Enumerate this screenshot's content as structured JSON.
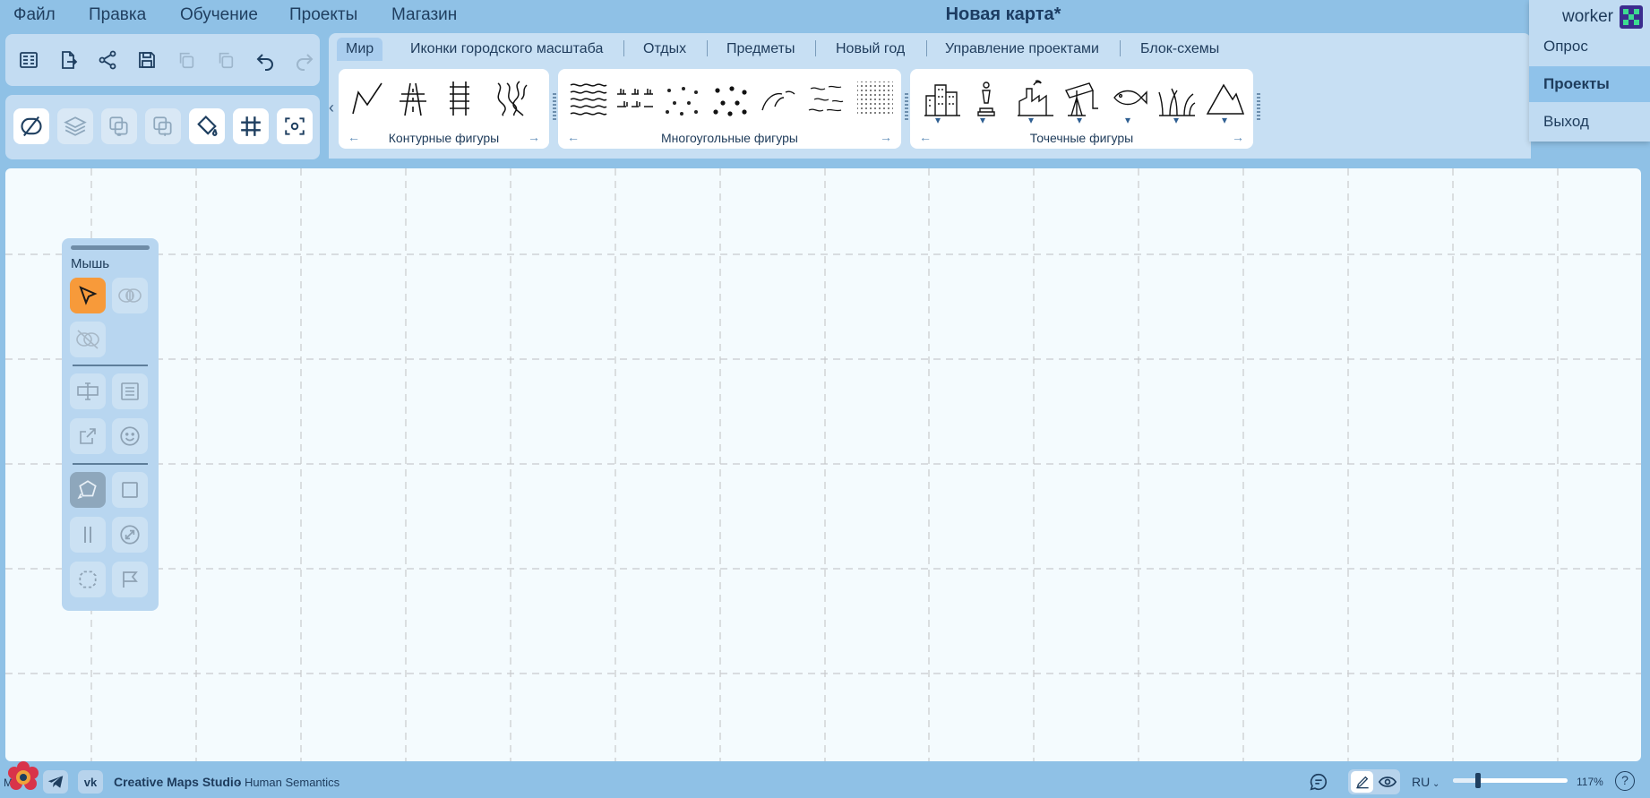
{
  "menu": {
    "items": [
      "Файл",
      "Правка",
      "Обучение",
      "Проекты",
      "Магазин"
    ],
    "title": "Новая карта*"
  },
  "user": {
    "name": "worker",
    "dropdown": [
      "Опрос",
      "Проекты",
      "Выход"
    ],
    "selected": "Проекты"
  },
  "tabs": [
    "Мир",
    "Иконки городского масштаба",
    "Отдых",
    "Предметы",
    "Новый год",
    "Управление проектами",
    "Блок-схемы"
  ],
  "active_tab": "Мир",
  "shape_groups": {
    "contour": {
      "label": "Контурные фигуры"
    },
    "polygon": {
      "label": "Многоугольные фигуры"
    },
    "point": {
      "label": "Точечные фигуры"
    }
  },
  "toolpanel": {
    "title": "Мышь"
  },
  "status": {
    "app_name": "Creative Maps Studio",
    "app_suffix": " - Human Semantics",
    "lang": "RU",
    "zoom": "117%",
    "zoom_fraction": 0.22,
    "left_char": "M"
  },
  "colors": {
    "accent_orange": "#f79a3a",
    "bg_blue": "#8fc1e6",
    "panel_blue": "#c3dcf2",
    "canvas": "#f4fbfe"
  }
}
